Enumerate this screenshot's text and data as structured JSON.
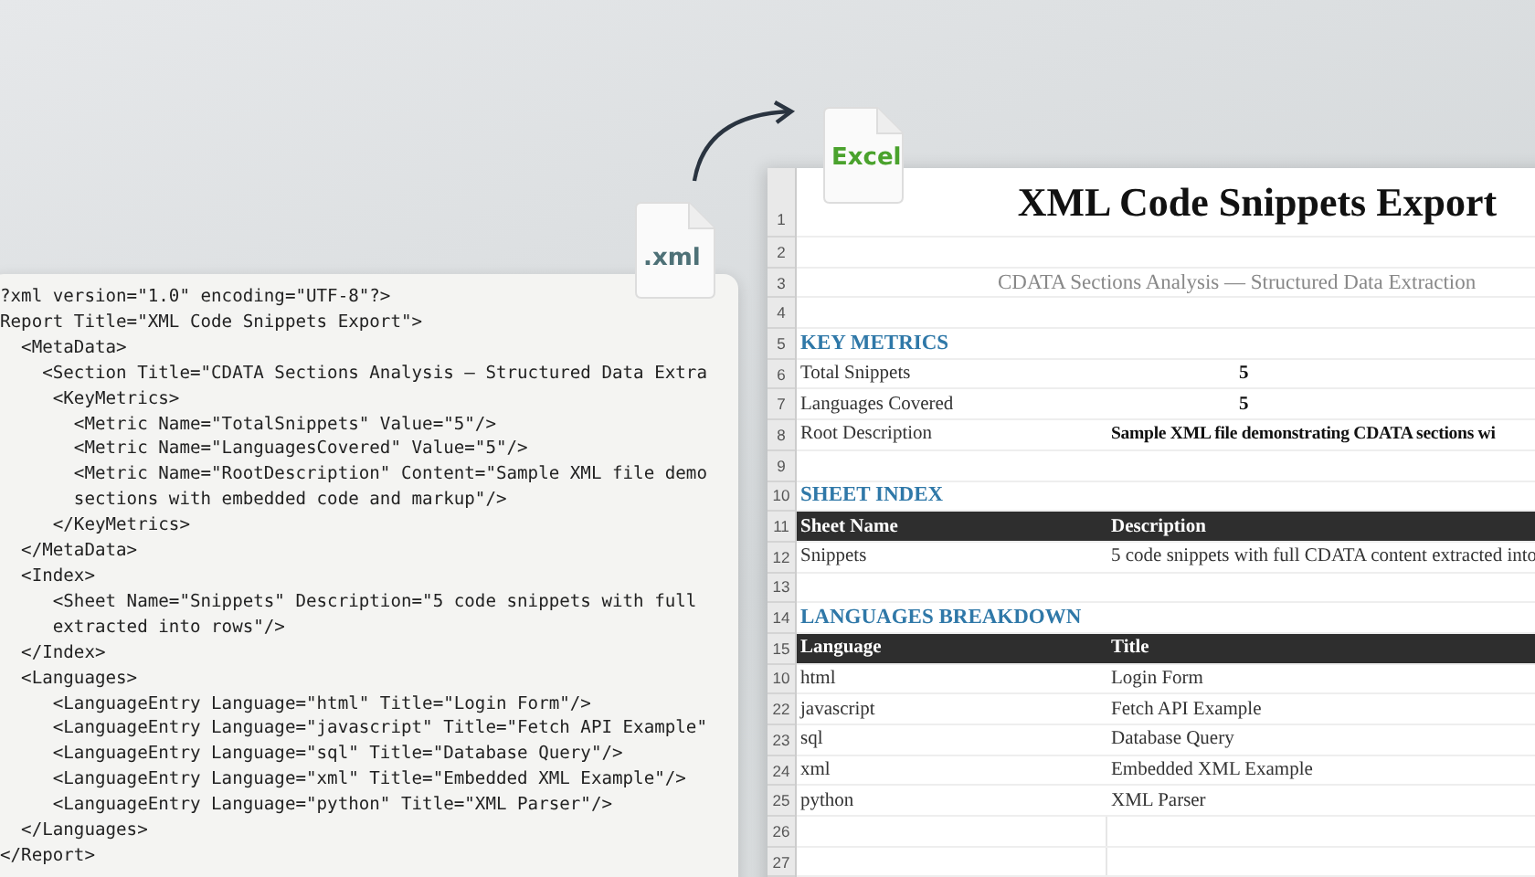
{
  "xml_file": {
    "label": ".xml"
  },
  "excel_file": {
    "label": "Excel"
  },
  "code_lines": [
    "?xml version=\"1.0\" encoding=\"UTF-8\"?>",
    "Report Title=\"XML Code Snippets Export\">",
    "  <MetaData>",
    "    <Section Title=\"CDATA Sections Analysis — Structured Data Extra",
    "     <KeyMetrics>",
    "       <Metric Name=\"TotalSnippets\" Value=\"5\"/>",
    "       <Metric Name=\"LanguagesCovered\" Value=\"5\"/>",
    "       <Metric Name=\"RootDescription\" Content=\"Sample XML file demo",
    "       sections with embedded code and markup\"/>",
    "     </KeyMetrics>",
    "  </MetaData>",
    "  <Index>",
    "     <Sheet Name=\"Snippets\" Description=\"5 code snippets with full",
    "     extracted into rows\"/>",
    "  </Index>",
    "  <Languages>",
    "     <LanguageEntry Language=\"html\" Title=\"Login Form\"/>",
    "     <LanguageEntry Language=\"javascript\" Title=\"Fetch API Example\"",
    "     <LanguageEntry Language=\"sql\" Title=\"Database Query\"/>",
    "     <LanguageEntry Language=\"xml\" Title=\"Embedded XML Example\"/>",
    "     <LanguageEntry Language=\"python\" Title=\"XML Parser\"/>",
    "  </Languages>",
    "</Report>"
  ],
  "sheet": {
    "rows": [
      {
        "number": "1",
        "kind": "title",
        "text": "XML Code Snippets Export"
      },
      {
        "number": "2",
        "kind": "blank"
      },
      {
        "number": "3",
        "kind": "subtitle",
        "text": "CDATA Sections Analysis — Structured Data Extraction"
      },
      {
        "number": "4",
        "kind": "blank"
      },
      {
        "number": "5",
        "kind": "section",
        "text": "KEY METRICS"
      },
      {
        "number": "6",
        "kind": "metric",
        "cells": [
          "Total Snippets",
          "5"
        ]
      },
      {
        "number": "7",
        "kind": "metric",
        "cells": [
          "Languages Covered",
          "5"
        ]
      },
      {
        "number": "8",
        "kind": "metric",
        "cells": [
          "Root Description",
          "Sample XML file demonstrating CDATA sections wi"
        ]
      },
      {
        "number": "9",
        "kind": "blank"
      },
      {
        "number": "10",
        "kind": "section",
        "text": "SHEET INDEX"
      },
      {
        "number": "11",
        "kind": "header",
        "cells": [
          "Sheet Name",
          "Description"
        ]
      },
      {
        "number": "12",
        "kind": "data",
        "cells": [
          "Snippets",
          "5 code snippets with full CDATA content extracted into"
        ]
      },
      {
        "number": "13",
        "kind": "blank"
      },
      {
        "number": "14",
        "kind": "section",
        "text": "LANGUAGES BREAKDOWN"
      },
      {
        "number": "15",
        "kind": "header",
        "cells": [
          "Language",
          "Title"
        ]
      },
      {
        "number": "10",
        "kind": "data",
        "cells": [
          "html",
          "Login Form"
        ]
      },
      {
        "number": "22",
        "kind": "data",
        "cells": [
          "javascript",
          "Fetch API Example"
        ]
      },
      {
        "number": "23",
        "kind": "data",
        "cells": [
          "sql",
          "Database Query"
        ]
      },
      {
        "number": "24",
        "kind": "data",
        "cells": [
          "xml",
          "Embedded XML Example"
        ]
      },
      {
        "number": "25",
        "kind": "data",
        "cells": [
          "python",
          "XML Parser"
        ]
      },
      {
        "number": "26",
        "kind": "grid"
      },
      {
        "number": "27",
        "kind": "grid"
      }
    ]
  }
}
